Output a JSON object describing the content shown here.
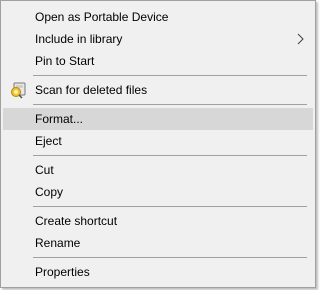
{
  "menu": {
    "items": [
      {
        "label": "Open as Portable Device"
      },
      {
        "label": "Include in library"
      },
      {
        "label": "Pin to Start"
      },
      {
        "label": "Scan for deleted files",
        "icon": "scan-disk-icon"
      },
      {
        "label": "Format..."
      },
      {
        "label": "Eject"
      },
      {
        "label": "Cut"
      },
      {
        "label": "Copy"
      },
      {
        "label": "Create shortcut"
      },
      {
        "label": "Rename"
      },
      {
        "label": "Properties"
      }
    ],
    "submenu_icon": "chevron-right-icon",
    "highlight_color": "#d7d7d7",
    "background_color": "#f0f0f0",
    "separator_color": "#a0a0a0"
  }
}
